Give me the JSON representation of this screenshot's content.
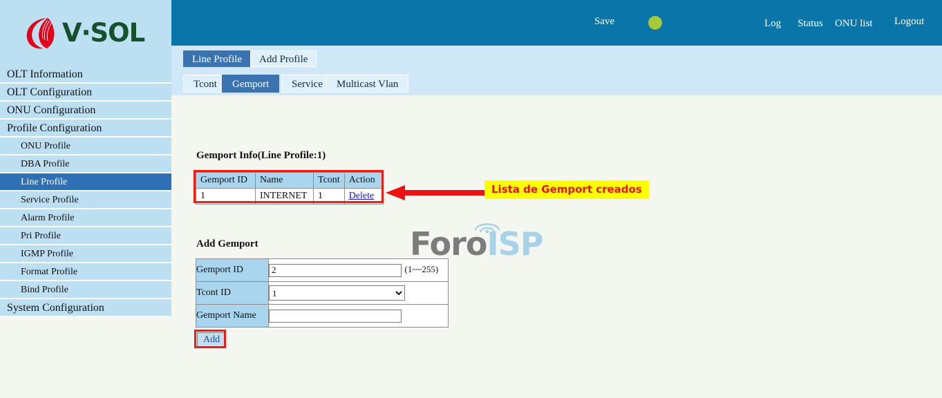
{
  "brand": {
    "name": "V·SOL",
    "logo_icon": "vsol-leaf-logo"
  },
  "topbar": {
    "save_label": "Save",
    "status_dot_color": "#a6c93a",
    "links": [
      {
        "label": "Log"
      },
      {
        "label": "Status"
      },
      {
        "label": "ONU list"
      },
      {
        "label": "Logout"
      }
    ]
  },
  "sidebar": {
    "items": [
      {
        "label": "OLT Information",
        "level": "top",
        "active": false
      },
      {
        "label": "OLT Configuration",
        "level": "top",
        "active": false
      },
      {
        "label": "ONU Configuration",
        "level": "top",
        "active": false
      },
      {
        "label": "Profile Configuration",
        "level": "top",
        "active": false
      },
      {
        "label": "ONU Profile",
        "level": "sub",
        "active": false
      },
      {
        "label": "DBA Profile",
        "level": "sub",
        "active": false
      },
      {
        "label": "Line Profile",
        "level": "sub",
        "active": true
      },
      {
        "label": "Service Profile",
        "level": "sub",
        "active": false
      },
      {
        "label": "Alarm Profile",
        "level": "sub",
        "active": false
      },
      {
        "label": "Pri Profile",
        "level": "sub",
        "active": false
      },
      {
        "label": "IGMP Profile",
        "level": "sub",
        "active": false
      },
      {
        "label": "Format Profile",
        "level": "sub",
        "active": false
      },
      {
        "label": "Bind Profile",
        "level": "sub",
        "active": false
      },
      {
        "label": "System Configuration",
        "level": "top",
        "active": false
      }
    ]
  },
  "main_tabs": [
    {
      "label": "Line Profile",
      "active": true
    },
    {
      "label": "Add Profile",
      "active": false
    }
  ],
  "sub_tabs": [
    {
      "label": "Tcont",
      "active": false
    },
    {
      "label": "Gemport",
      "active": true,
      "highlighted": true
    },
    {
      "label": "Service",
      "active": false
    },
    {
      "label": "Multicast Vlan",
      "active": false
    }
  ],
  "gemport_info": {
    "title": "Gemport Info(Line Profile:1)",
    "columns": [
      "Gemport ID",
      "Name",
      "Tcont",
      "Action"
    ],
    "rows": [
      {
        "gemport_id": "1",
        "name": "INTERNET",
        "tcont": "1",
        "action": "Delete"
      }
    ],
    "highlight_color": "#ee1c11"
  },
  "annotation": {
    "text": "Lista de Gemport creados",
    "text_color": "#ee1111",
    "background_color": "#ffff00",
    "arrow_color": "#ee1111"
  },
  "watermark": {
    "part1": "Foro",
    "part2": "ISP",
    "part1_color": "#7c7c7c",
    "part2_color": "#a8d2e8"
  },
  "add_gemport": {
    "title": "Add Gemport",
    "fields": [
      {
        "label": "Gemport ID",
        "value": "2",
        "placeholder": "",
        "hint": "(1~~255)",
        "type": "text"
      },
      {
        "label": "Tcont ID",
        "value": "1",
        "options": [
          "1"
        ],
        "type": "select"
      },
      {
        "label": "Gemport Name",
        "value": "",
        "placeholder": "",
        "type": "text"
      }
    ],
    "submit_label": "Add"
  }
}
